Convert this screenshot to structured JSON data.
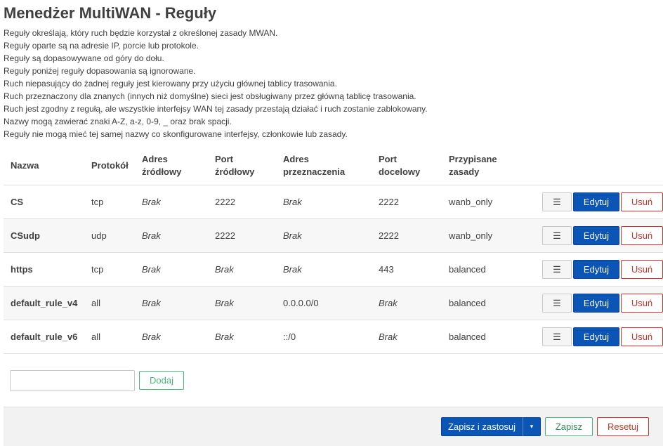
{
  "page": {
    "title": "Menedżer MultiWAN - Reguły",
    "description": [
      "Reguły określają, który ruch będzie korzystał z określonej zasady MWAN.",
      "Reguły oparte są na adresie IP, porcie lub protokole.",
      "Reguły są dopasowywane od góry do dołu.",
      "Reguły poniżej reguły dopasowania są ignorowane.",
      "Ruch niepasujący do żadnej reguły jest kierowany przy użyciu głównej tablicy trasowania.",
      "Ruch przeznaczony dla znanych (innych niż domyślne) sieci jest obsługiwany przez główną tablicę trasowania.",
      "Ruch jest zgodny z regułą, ale wszystkie interfejsy WAN tej zasady przestają działać i ruch zostanie zablokowany.",
      "Nazwy mogą zawierać znaki A-Z, a-z, 0-9, _ oraz brak spacji.",
      "Reguły nie mogą mieć tej samej nazwy co skonfigurowane interfejsy, członkowie lub zasady."
    ]
  },
  "table": {
    "headers": {
      "name": "Nazwa",
      "proto": "Protokół",
      "src_ip_1": "Adres",
      "src_ip_2": "źródłowy",
      "src_port_1": "Port",
      "src_port_2": "źródłowy",
      "dest_ip_1": "Adres",
      "dest_ip_2": "przeznaczenia",
      "dest_port_1": "Port",
      "dest_port_2": "docelowy",
      "policy_1": "Przypisane",
      "policy_2": "zasady"
    },
    "rows": [
      {
        "name": "CS",
        "proto": "tcp",
        "src_ip": "Brak",
        "src_port": "2222",
        "dest_ip": "Brak",
        "dest_port": "2222",
        "policy": "wanb_only"
      },
      {
        "name": "CSudp",
        "proto": "udp",
        "src_ip": "Brak",
        "src_port": "2222",
        "dest_ip": "Brak",
        "dest_port": "2222",
        "policy": "wanb_only"
      },
      {
        "name": "https",
        "proto": "tcp",
        "src_ip": "Brak",
        "src_port": "Brak",
        "dest_ip": "Brak",
        "dest_port": "443",
        "policy": "balanced"
      },
      {
        "name": "default_rule_v4",
        "proto": "all",
        "src_ip": "Brak",
        "src_port": "Brak",
        "dest_ip": "0.0.0.0/0",
        "dest_port": "Brak",
        "policy": "balanced"
      },
      {
        "name": "default_rule_v6",
        "proto": "all",
        "src_ip": "Brak",
        "src_port": "Brak",
        "dest_ip": "::/0",
        "dest_port": "Brak",
        "policy": "balanced"
      }
    ],
    "actions": {
      "menu_glyph": "☰",
      "edit_label": "Edytuj",
      "delete_label": "Usuń"
    }
  },
  "add_row": {
    "input_value": "",
    "add_label": "Dodaj"
  },
  "footer": {
    "save_apply_label": "Zapisz i zastosuj",
    "caret_glyph": "▾",
    "save_label": "Zapisz",
    "reset_label": "Resetuj"
  },
  "colors": {
    "primary": "#0b55b5",
    "positive": "#4ab67e",
    "negative": "#c0392b"
  }
}
